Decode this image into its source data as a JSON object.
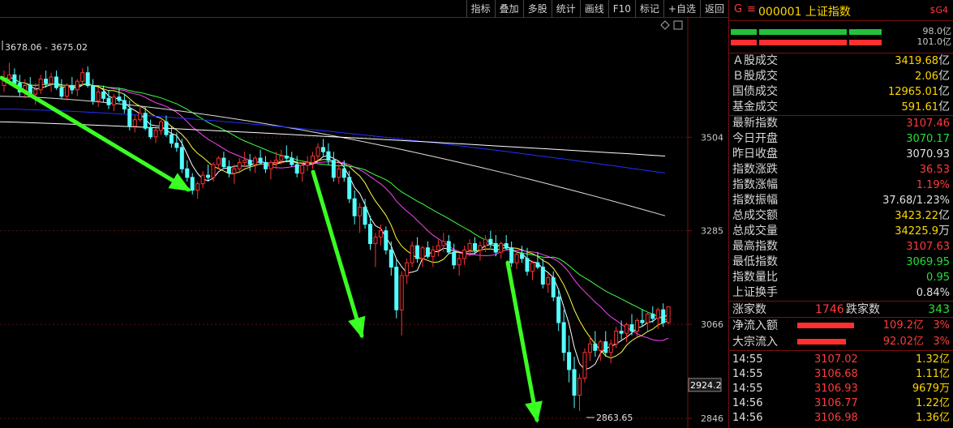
{
  "toolbar": {
    "buttons": [
      "指标",
      "叠加",
      "多股",
      "统计",
      "画线",
      "F10",
      "标记",
      "+自选",
      "返回"
    ]
  },
  "chart_data": {
    "type": "candlestick",
    "ylim": [
      2846,
      3700
    ],
    "y_ticks": [
      "3504",
      "3285",
      "3066",
      "2846"
    ],
    "price_box": "2924.2",
    "annotation_high": "3678.06 - 3675.02",
    "annotation_low": "2863.65",
    "candles": [
      [
        3625,
        3660,
        3610,
        3640
      ],
      [
        3640,
        3678,
        3630,
        3650
      ],
      [
        3650,
        3665,
        3620,
        3630
      ],
      [
        3630,
        3650,
        3600,
        3610
      ],
      [
        3610,
        3640,
        3595,
        3625
      ],
      [
        3625,
        3645,
        3600,
        3605
      ],
      [
        3605,
        3630,
        3580,
        3615
      ],
      [
        3615,
        3650,
        3605,
        3640
      ],
      [
        3640,
        3660,
        3620,
        3630
      ],
      [
        3630,
        3655,
        3610,
        3645
      ],
      [
        3645,
        3660,
        3615,
        3620
      ],
      [
        3620,
        3640,
        3595,
        3600
      ],
      [
        3600,
        3630,
        3590,
        3625
      ],
      [
        3625,
        3645,
        3605,
        3615
      ],
      [
        3615,
        3640,
        3600,
        3635
      ],
      [
        3635,
        3665,
        3625,
        3655
      ],
      [
        3655,
        3670,
        3620,
        3625
      ],
      [
        3625,
        3640,
        3580,
        3590
      ],
      [
        3590,
        3620,
        3575,
        3610
      ],
      [
        3610,
        3625,
        3585,
        3595
      ],
      [
        3595,
        3615,
        3570,
        3580
      ],
      [
        3580,
        3605,
        3565,
        3598
      ],
      [
        3598,
        3620,
        3585,
        3590
      ],
      [
        3590,
        3605,
        3560,
        3570
      ],
      [
        3570,
        3590,
        3520,
        3530
      ],
      [
        3530,
        3555,
        3515,
        3545
      ],
      [
        3545,
        3575,
        3540,
        3560
      ],
      [
        3560,
        3575,
        3520,
        3525
      ],
      [
        3525,
        3545,
        3500,
        3505
      ],
      [
        3505,
        3525,
        3490,
        3520
      ],
      [
        3520,
        3545,
        3510,
        3540
      ],
      [
        3540,
        3555,
        3505,
        3510
      ],
      [
        3510,
        3530,
        3480,
        3490
      ],
      [
        3490,
        3515,
        3470,
        3480
      ],
      [
        3480,
        3500,
        3420,
        3430
      ],
      [
        3430,
        3450,
        3400,
        3410
      ],
      [
        3410,
        3420,
        3370,
        3380
      ],
      [
        3380,
        3400,
        3360,
        3395
      ],
      [
        3395,
        3425,
        3385,
        3415
      ],
      [
        3415,
        3440,
        3400,
        3410
      ],
      [
        3410,
        3445,
        3400,
        3440
      ],
      [
        3440,
        3460,
        3430,
        3455
      ],
      [
        3455,
        3470,
        3430,
        3435
      ],
      [
        3435,
        3450,
        3410,
        3420
      ],
      [
        3420,
        3440,
        3395,
        3430
      ],
      [
        3430,
        3455,
        3420,
        3445
      ],
      [
        3445,
        3470,
        3435,
        3450
      ],
      [
        3450,
        3465,
        3425,
        3440
      ],
      [
        3440,
        3460,
        3420,
        3455
      ],
      [
        3455,
        3475,
        3440,
        3445
      ],
      [
        3445,
        3460,
        3420,
        3430
      ],
      [
        3430,
        3450,
        3405,
        3445
      ],
      [
        3445,
        3470,
        3430,
        3450
      ],
      [
        3450,
        3475,
        3440,
        3460
      ],
      [
        3460,
        3485,
        3445,
        3455
      ],
      [
        3455,
        3470,
        3435,
        3440
      ],
      [
        3440,
        3460,
        3410,
        3420
      ],
      [
        3420,
        3445,
        3400,
        3438
      ],
      [
        3438,
        3460,
        3425,
        3445
      ],
      [
        3445,
        3470,
        3430,
        3460
      ],
      [
        3460,
        3490,
        3450,
        3480
      ],
      [
        3480,
        3500,
        3460,
        3470
      ],
      [
        3470,
        3490,
        3440,
        3450
      ],
      [
        3450,
        3470,
        3400,
        3410
      ],
      [
        3410,
        3440,
        3395,
        3430
      ],
      [
        3430,
        3450,
        3400,
        3410
      ],
      [
        3410,
        3425,
        3350,
        3360
      ],
      [
        3360,
        3380,
        3300,
        3320
      ],
      [
        3320,
        3350,
        3280,
        3340
      ],
      [
        3340,
        3360,
        3290,
        3300
      ],
      [
        3300,
        3320,
        3240,
        3255
      ],
      [
        3255,
        3280,
        3200,
        3270
      ],
      [
        3270,
        3300,
        3250,
        3285
      ],
      [
        3285,
        3295,
        3230,
        3240
      ],
      [
        3240,
        3260,
        3180,
        3200
      ],
      [
        3200,
        3220,
        3080,
        3100
      ],
      [
        3100,
        3190,
        3040,
        3180
      ],
      [
        3180,
        3220,
        3160,
        3210
      ],
      [
        3210,
        3260,
        3200,
        3250
      ],
      [
        3250,
        3270,
        3210,
        3220
      ],
      [
        3220,
        3250,
        3200,
        3245
      ],
      [
        3245,
        3260,
        3220,
        3225
      ],
      [
        3225,
        3250,
        3200,
        3240
      ],
      [
        3240,
        3265,
        3225,
        3250
      ],
      [
        3250,
        3280,
        3235,
        3260
      ],
      [
        3260,
        3275,
        3230,
        3235
      ],
      [
        3235,
        3255,
        3195,
        3205
      ],
      [
        3205,
        3230,
        3180,
        3220
      ],
      [
        3220,
        3250,
        3205,
        3240
      ],
      [
        3240,
        3265,
        3225,
        3255
      ],
      [
        3255,
        3270,
        3230,
        3240
      ],
      [
        3240,
        3260,
        3215,
        3250
      ],
      [
        3250,
        3275,
        3235,
        3265
      ],
      [
        3265,
        3285,
        3245,
        3255
      ],
      [
        3255,
        3275,
        3225,
        3235
      ],
      [
        3235,
        3260,
        3220,
        3255
      ],
      [
        3255,
        3275,
        3240,
        3245
      ],
      [
        3245,
        3260,
        3200,
        3210
      ],
      [
        3210,
        3240,
        3195,
        3230
      ],
      [
        3230,
        3250,
        3210,
        3220
      ],
      [
        3220,
        3245,
        3180,
        3190
      ],
      [
        3190,
        3215,
        3170,
        3210
      ],
      [
        3210,
        3235,
        3195,
        3200
      ],
      [
        3200,
        3220,
        3150,
        3160
      ],
      [
        3160,
        3185,
        3140,
        3175
      ],
      [
        3175,
        3190,
        3120,
        3130
      ],
      [
        3130,
        3150,
        3050,
        3070
      ],
      [
        3070,
        3100,
        2980,
        3000
      ],
      [
        3000,
        3040,
        2930,
        2960
      ],
      [
        2960,
        2990,
        2870,
        2900
      ],
      [
        2900,
        2950,
        2863,
        2940
      ],
      [
        2940,
        3010,
        2930,
        3000
      ],
      [
        3000,
        3040,
        2980,
        3020
      ],
      [
        3020,
        3050,
        2990,
        3005
      ],
      [
        3005,
        3030,
        2980,
        3025
      ],
      [
        3025,
        3050,
        2990,
        3000
      ],
      [
        3000,
        3030,
        2975,
        3020
      ],
      [
        3020,
        3060,
        3010,
        3050
      ],
      [
        3050,
        3075,
        3030,
        3045
      ],
      [
        3045,
        3070,
        3025,
        3065
      ],
      [
        3065,
        3090,
        3040,
        3050
      ],
      [
        3050,
        3080,
        3035,
        3075
      ],
      [
        3075,
        3100,
        3060,
        3070
      ],
      [
        3070,
        3095,
        3050,
        3090
      ],
      [
        3090,
        3108,
        3070,
        3080
      ],
      [
        3080,
        3105,
        3055,
        3100
      ],
      [
        3100,
        3115,
        3060,
        3070
      ],
      [
        3070,
        3108,
        3065,
        3107
      ]
    ]
  },
  "panel": {
    "header": {
      "g": "G",
      "menu": "≡",
      "code_name": "000001 上证指数",
      "sig": "$G4"
    },
    "bars": [
      {
        "color": "#22c33a",
        "value": "98.0亿"
      },
      {
        "color": "#ff3030",
        "value": "101.0亿"
      }
    ],
    "volume": [
      {
        "label": "Ａ股成交",
        "value": "3419.68",
        "unit": "亿",
        "color": "#ffd700"
      },
      {
        "label": "Ｂ股成交",
        "value": "2.06",
        "unit": "亿",
        "color": "#ffd700"
      },
      {
        "label": "国债成交",
        "value": "12965.01",
        "unit": "亿",
        "color": "#ffd700"
      },
      {
        "label": "基金成交",
        "value": "591.61",
        "unit": "亿",
        "color": "#ffd700"
      }
    ],
    "stats": [
      {
        "label": "最新指数",
        "value": "3107.46",
        "unit": "",
        "color": "#ff3b3b"
      },
      {
        "label": "今日开盘",
        "value": "3070.17",
        "unit": "",
        "color": "#22e03a"
      },
      {
        "label": "昨日收盘",
        "value": "3070.93",
        "unit": "",
        "color": "#e0e0e0"
      },
      {
        "label": "指数涨跌",
        "value": "36.53",
        "unit": "",
        "color": "#ff3b3b"
      },
      {
        "label": "指数涨幅",
        "value": "1.19%",
        "unit": "",
        "color": "#ff3b3b"
      },
      {
        "label": "指数振幅",
        "value": "37.68/1.23%",
        "unit": "",
        "color": "#e0e0e0"
      },
      {
        "label": "总成交额",
        "value": "3423.22",
        "unit": "亿",
        "color": "#ffd700"
      },
      {
        "label": "总成交量",
        "value": "34225.9",
        "unit": "万",
        "color": "#ffd700"
      },
      {
        "label": "最高指数",
        "value": "3107.63",
        "unit": "",
        "color": "#ff3b3b"
      },
      {
        "label": "最低指数",
        "value": "3069.95",
        "unit": "",
        "color": "#22e03a"
      },
      {
        "label": "指数量比",
        "value": "0.95",
        "unit": "",
        "color": "#22e03a"
      },
      {
        "label": "上证换手",
        "value": "0.84%",
        "unit": "",
        "color": "#e0e0e0"
      }
    ],
    "counts": {
      "up_label": "涨家数",
      "up_value": "1746",
      "down_label": "跌家数",
      "down_value": "343"
    },
    "flows": [
      {
        "label": "净流入额",
        "value": "109.2亿",
        "pct": "3%"
      },
      {
        "label": "大宗流入",
        "value": "92.02亿",
        "pct": "3%"
      }
    ],
    "ticks": [
      {
        "time": "14:55",
        "price": "3107.02",
        "vol": "1.32亿"
      },
      {
        "time": "14:55",
        "price": "3106.68",
        "vol": "1.11亿"
      },
      {
        "time": "14:55",
        "price": "3106.93",
        "vol": "9679万"
      },
      {
        "time": "14:56",
        "price": "3106.77",
        "vol": "1.22亿"
      },
      {
        "time": "14:56",
        "price": "3106.98",
        "vol": "1.36亿"
      }
    ]
  }
}
